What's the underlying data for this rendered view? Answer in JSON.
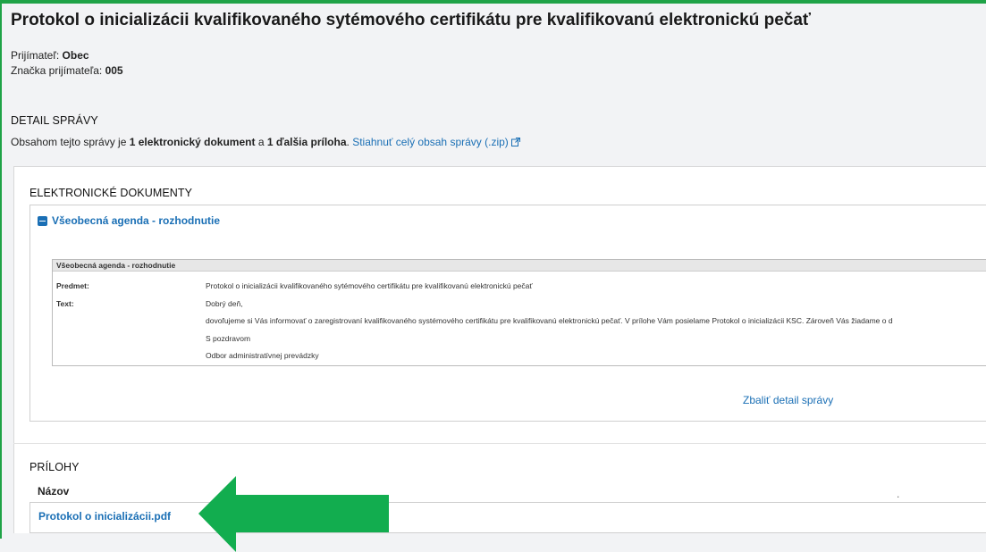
{
  "title": "Protokol o inicializácii kvalifikovaného sytémového certifikátu pre kvalifikovanú elektronickú pečať",
  "recipient": {
    "label": "Prijímateľ:",
    "value": "Obec"
  },
  "recipient_code": {
    "label": "Značka prijímateľa:",
    "value": "005"
  },
  "message_detail": {
    "heading": "DETAIL SPRÁVY",
    "summary_prefix": "Obsahom tejto správy je",
    "summary_docs": "1 elektronický dokument",
    "summary_and": "a",
    "summary_attachments": "1 ďalšia príloha",
    "summary_suffix": ".",
    "download_link": "Stiahnuť celý obsah správy (.zip)"
  },
  "electronic_documents": {
    "heading": "ELEKTRONICKÉ DOKUMENTY",
    "document_title": "Všeobecná agenda - rozhodnutie",
    "inner_table": {
      "header": "Všeobecná agenda - rozhodnutie",
      "subject_label": "Predmet:",
      "subject_value": "Protokol  o inicializácii kvalifikovaného sytémového certifikátu pre kvalifikovanú elektronickú pečať",
      "text_label": "Text:",
      "text_lines": [
        "Dobrý deň,",
        "dovoľujeme si Vás informovať o zaregistrovaní kvalifikovaného systémového certifikátu pre kvalifikovanú elektronickú pečať.  V prílohe Vám posielame Protokol o inicializácii  KSC. Zároveň Vás žiadame o d",
        "S pozdravom",
        "Odbor administratívnej prevádzky"
      ]
    },
    "collapse_link": "Zbaliť detail správy"
  },
  "attachments": {
    "heading": "PRÍLOHY",
    "column_name": "Názov",
    "column_dot": ".",
    "files": [
      "Protokol o inicializácii.pdf"
    ]
  },
  "colors": {
    "accent_green": "#1fa347",
    "link_blue": "#1a6fb5",
    "arrow_green": "#12ad4f"
  }
}
